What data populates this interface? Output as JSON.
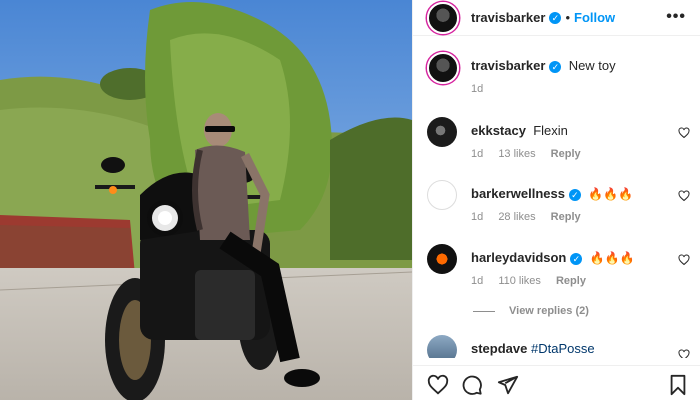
{
  "header": {
    "username": "travisbarker",
    "separator": "•",
    "follow_label": "Follow",
    "more_icon": "•••"
  },
  "caption": {
    "username": "travisbarker",
    "text": "New toy",
    "time": "1d"
  },
  "comments": [
    {
      "username": "ekkstacy",
      "verified": false,
      "text": "Flexin",
      "time": "1d",
      "likes": "13 likes",
      "reply": "Reply"
    },
    {
      "username": "barkerwellness",
      "verified": true,
      "text": "🔥🔥🔥",
      "time": "1d",
      "likes": "28 likes",
      "reply": "Reply"
    },
    {
      "username": "harleydavidson",
      "verified": true,
      "text": "🔥🔥🔥",
      "time": "1d",
      "likes": "110 likes",
      "reply": "Reply"
    },
    {
      "username": "stepdave",
      "verified": false,
      "text": "#DtaPosse"
    }
  ],
  "view_replies_label": "View replies (2)",
  "colors": {
    "accent": "#0095f6",
    "text": "#262626",
    "muted": "#8e8e8e"
  },
  "icons": [
    "heart-icon",
    "comment-icon",
    "share-icon",
    "bookmark-icon",
    "verified-icon",
    "more-icon"
  ]
}
